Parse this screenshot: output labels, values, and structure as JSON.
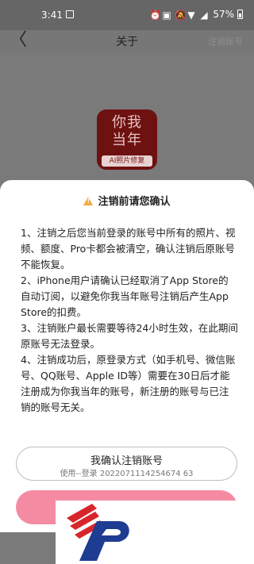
{
  "status": {
    "time": "3:41",
    "battery": "57%"
  },
  "nav": {
    "title": "关于",
    "right": "注销账号"
  },
  "logo": {
    "line1": "你我",
    "line2": "当年",
    "tag": "AI照片修复"
  },
  "dialog": {
    "title": "注销前请您确认",
    "items": [
      "1、注销之后您当前登录的账号中所有的照片、视频、额度、Pro卡都会被清空，确认注销后原账号不能恢复。",
      "2、iPhone用户请确认已经取消了App Store的自动订阅，以避免你我当年账号注销后产生App Store的扣费。",
      "3、注销账户最长需要等待24小时生效，在此期间原账号无法登录。",
      "4、注销成功后，原登录方式（如手机号、微信账号、QQ账号、Apple ID等）需要在30日后才能注册成为你我当年的账号，新注册的账号与已注销的账号无关。"
    ],
    "confirm_label": "我确认注销账号",
    "confirm_sub": "使用--登录 2022071114254674 63"
  },
  "colors": {
    "pink": "#f48ba2",
    "warn": "#f3a93b"
  }
}
